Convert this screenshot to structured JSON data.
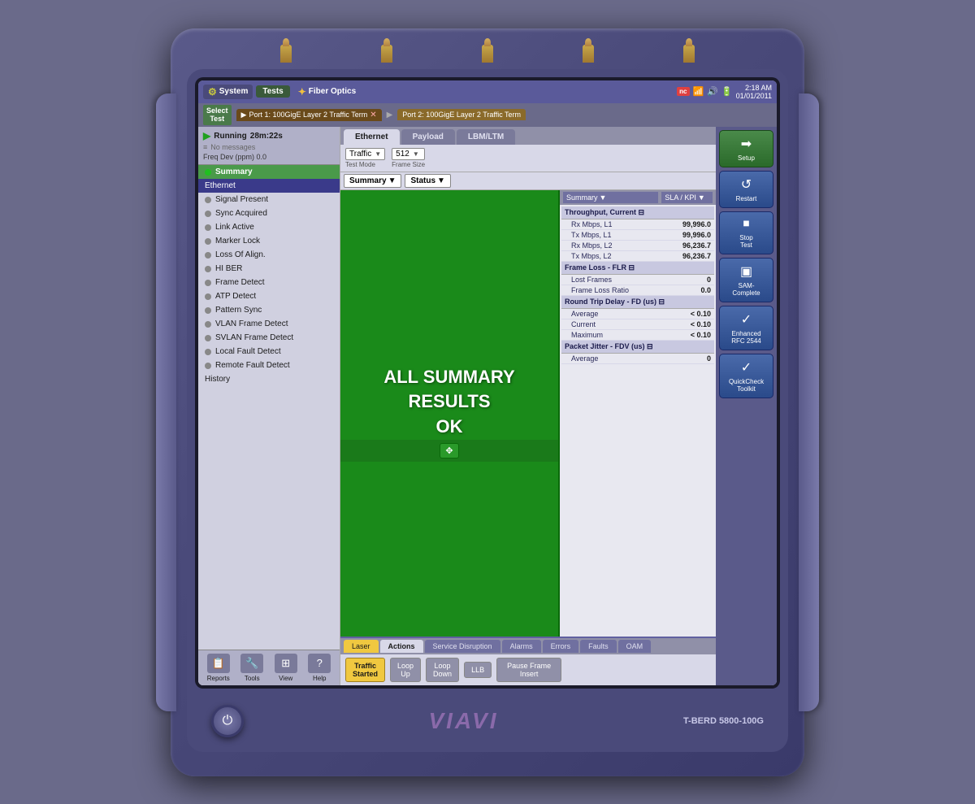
{
  "device": {
    "model": "T-BERD 5800-100G",
    "brand": "VIAVI"
  },
  "menu_bar": {
    "system_label": "System",
    "tests_label": "Tests",
    "fiber_label": "Fiber Optics",
    "nc_badge": "nc",
    "time": "2:18 AM",
    "date": "01/01/2011"
  },
  "select_test": {
    "label_line1": "Select",
    "label_line2": "Test",
    "port1_label": "Port 1: 100GigE Layer 2 Traffic Term",
    "port2_label": "Port 2: 100GigE Layer 2 Traffic Term"
  },
  "running_bar": {
    "status": "Running",
    "time": "28m:22s",
    "messages": "No messages",
    "freq_dev_label": "Freq Dev (ppm)",
    "freq_dev_value": "0.0"
  },
  "nav_items": [
    {
      "label": "Summary",
      "dot": "green",
      "active": false,
      "summary": true
    },
    {
      "label": "Ethernet",
      "dot": "none",
      "active": true
    },
    {
      "label": "Signal Present",
      "dot": "gray"
    },
    {
      "label": "Sync Acquired",
      "dot": "gray"
    },
    {
      "label": "Link Active",
      "dot": "gray"
    },
    {
      "label": "Marker Lock",
      "dot": "gray"
    },
    {
      "label": "Loss Of Align.",
      "dot": "gray"
    },
    {
      "label": "HI BER",
      "dot": "gray"
    },
    {
      "label": "Frame Detect",
      "dot": "gray"
    },
    {
      "label": "ATP Detect",
      "dot": "gray"
    },
    {
      "label": "Pattern Sync",
      "dot": "gray"
    },
    {
      "label": "VLAN Frame Detect",
      "dot": "gray"
    },
    {
      "label": "SVLAN Frame Detect",
      "dot": "gray"
    },
    {
      "label": "Local Fault Detect",
      "dot": "gray"
    },
    {
      "label": "Remote Fault Detect",
      "dot": "gray"
    },
    {
      "label": "History",
      "dot": "none"
    }
  ],
  "bottom_nav": [
    {
      "label": "Reports",
      "icon": "📋"
    },
    {
      "label": "Tools",
      "icon": "🔧"
    },
    {
      "label": "View",
      "icon": "⊞"
    },
    {
      "label": "Help",
      "icon": "?"
    }
  ],
  "tabs": {
    "ethernet": "Ethernet",
    "payload": "Payload",
    "lbm": "LBM/LTM"
  },
  "controls": {
    "test_mode_label": "Test Mode",
    "test_mode_value": "Traffic",
    "frame_size_label": "Frame Size",
    "frame_size_value": "512"
  },
  "summary_dropdowns": {
    "left": "Summary",
    "right": "Status",
    "col3": "Summary",
    "col4": "SLA / KPI"
  },
  "green_panel": {
    "line1": "ALL SUMMARY",
    "line2": "RESULTS",
    "line3": "OK"
  },
  "data_sections": [
    {
      "header": "Throughput, Current ⊟",
      "rows": [
        {
          "label": "Rx Mbps, L1",
          "value": "99,996.0"
        },
        {
          "label": "Tx Mbps, L1",
          "value": "99,996.0"
        },
        {
          "label": "Rx Mbps, L2",
          "value": "96,236.7"
        },
        {
          "label": "Tx Mbps, L2",
          "value": "96,236.7"
        }
      ]
    },
    {
      "header": "Frame Loss - FLR ⊟",
      "rows": [
        {
          "label": "Lost Frames",
          "value": "0"
        },
        {
          "label": "Frame Loss Ratio",
          "value": "0.0"
        }
      ]
    },
    {
      "header": "Round Trip Delay - FD (us) ⊟",
      "rows": [
        {
          "label": "Average",
          "value": "< 0.10"
        },
        {
          "label": "Current",
          "value": "< 0.10"
        },
        {
          "label": "Maximum",
          "value": "< 0.10"
        }
      ]
    },
    {
      "header": "Packet Jitter - FDV (us) ⊟",
      "rows": [
        {
          "label": "Average",
          "value": "0"
        }
      ]
    }
  ],
  "action_tabs": [
    {
      "label": "Laser",
      "type": "laser"
    },
    {
      "label": "Actions",
      "type": "active"
    },
    {
      "label": "Service Disruption",
      "type": "inactive"
    },
    {
      "label": "Alarms",
      "type": "inactive"
    },
    {
      "label": "Errors",
      "type": "inactive"
    },
    {
      "label": "Faults",
      "type": "inactive"
    },
    {
      "label": "OAM",
      "type": "inactive"
    }
  ],
  "action_buttons": [
    {
      "label": "Traffic\nStarted",
      "type": "active"
    },
    {
      "label": "Loop\nUp",
      "type": "normal"
    },
    {
      "label": "Loop\nDown",
      "type": "normal"
    },
    {
      "label": "LLB",
      "type": "normal"
    },
    {
      "label": "Pause Frame\nInsert",
      "type": "normal",
      "wide": true
    }
  ],
  "right_sidebar_buttons": [
    {
      "label": "Setup",
      "icon": "➡",
      "type": "green"
    },
    {
      "label": "Restart",
      "icon": "↺",
      "type": "blue"
    },
    {
      "label": "Stop\nTest",
      "icon": "⏹",
      "type": "blue"
    },
    {
      "label": "SAM-\nComplete",
      "icon": "▣",
      "type": "blue"
    },
    {
      "label": "Enhanced\nRFC 2544",
      "icon": "✓",
      "type": "blue"
    },
    {
      "label": "QuickCheck\nToolkit",
      "icon": "✓",
      "type": "blue"
    }
  ]
}
